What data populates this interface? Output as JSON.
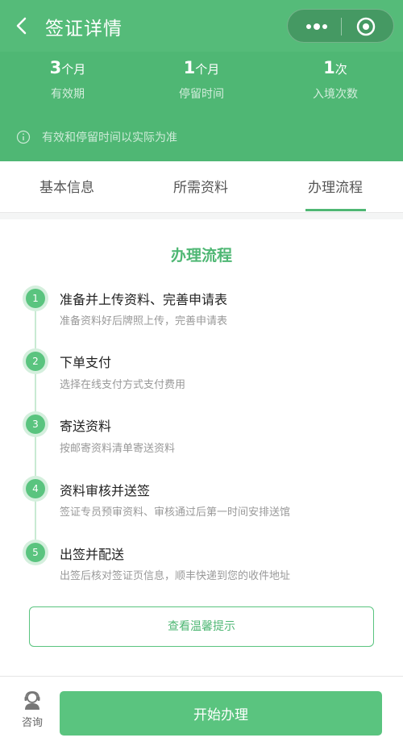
{
  "header": {
    "title": "签证详情",
    "stats": [
      {
        "value": "3",
        "unit": "个月",
        "label": "有效期"
      },
      {
        "value": "1",
        "unit": "个月",
        "label": "停留时间"
      },
      {
        "value": "1",
        "unit": "次",
        "label": "入境次数"
      }
    ],
    "notice": "有效和停留时间以实际为准"
  },
  "tabs": [
    {
      "label": "基本信息"
    },
    {
      "label": "所需资料"
    },
    {
      "label": "办理流程"
    }
  ],
  "process": {
    "title": "办理流程",
    "steps": [
      {
        "num": "1",
        "title": "准备并上传资料、完善申请表",
        "desc": "准备资料好后牌照上传，完善申请表"
      },
      {
        "num": "2",
        "title": "下单支付",
        "desc": "选择在线支付方式支付费用"
      },
      {
        "num": "3",
        "title": "寄送资料",
        "desc": "按邮寄资料清单寄送资料"
      },
      {
        "num": "4",
        "title": "资料审核并送签",
        "desc": "签证专员预审资料、审核通过后第一时间安排送馆"
      },
      {
        "num": "5",
        "title": "出签并配送",
        "desc": "出签后核对签证页信息，顺丰快递到您的收件地址"
      }
    ],
    "tips_button": "查看温馨提示"
  },
  "bottom": {
    "consult_label": "咨询",
    "start_button": "开始办理"
  },
  "colors": {
    "brand": "#4fb774",
    "accent": "#5ac47f"
  }
}
